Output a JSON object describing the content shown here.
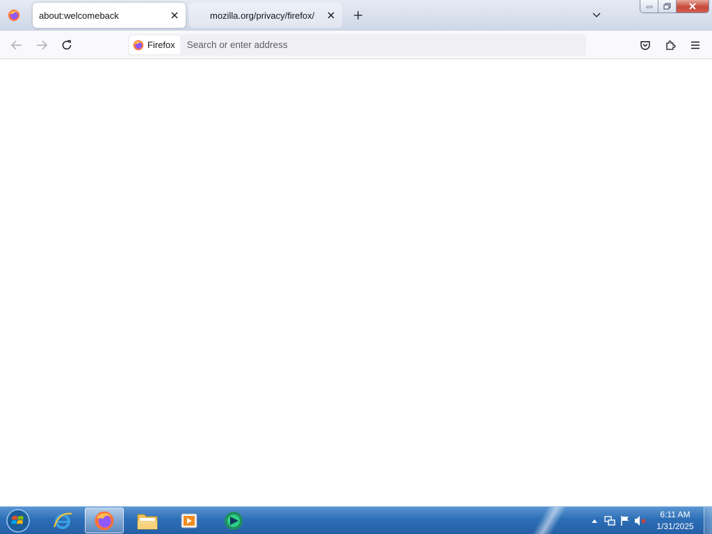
{
  "browser": {
    "tabs": [
      {
        "title": "about:welcomeback",
        "active": true
      },
      {
        "title": "mozilla.org/privacy/firefox/",
        "active": false
      }
    ],
    "identity_label": "Firefox",
    "url_placeholder": "Search or enter address",
    "url_value": ""
  },
  "icons": {
    "firefox": "firefox-icon",
    "close": "close-icon",
    "new_tab": "plus-icon",
    "tab_list": "chevron-down-icon",
    "back": "back-arrow-icon",
    "forward": "forward-arrow-icon",
    "reload": "reload-icon",
    "pocket": "pocket-icon",
    "extensions": "puzzle-icon",
    "menu": "hamburger-icon"
  },
  "taskbar": {
    "pinned": [
      "start-orb",
      "internet-explorer",
      "firefox",
      "file-explorer",
      "media-player",
      "app"
    ],
    "clock": {
      "time": "6:11 AM",
      "date": "1/31/2025"
    }
  },
  "colors": {
    "accent": "#2d6fb7",
    "tab_strip": "#d6deeb",
    "close_button": "#c7483a"
  }
}
